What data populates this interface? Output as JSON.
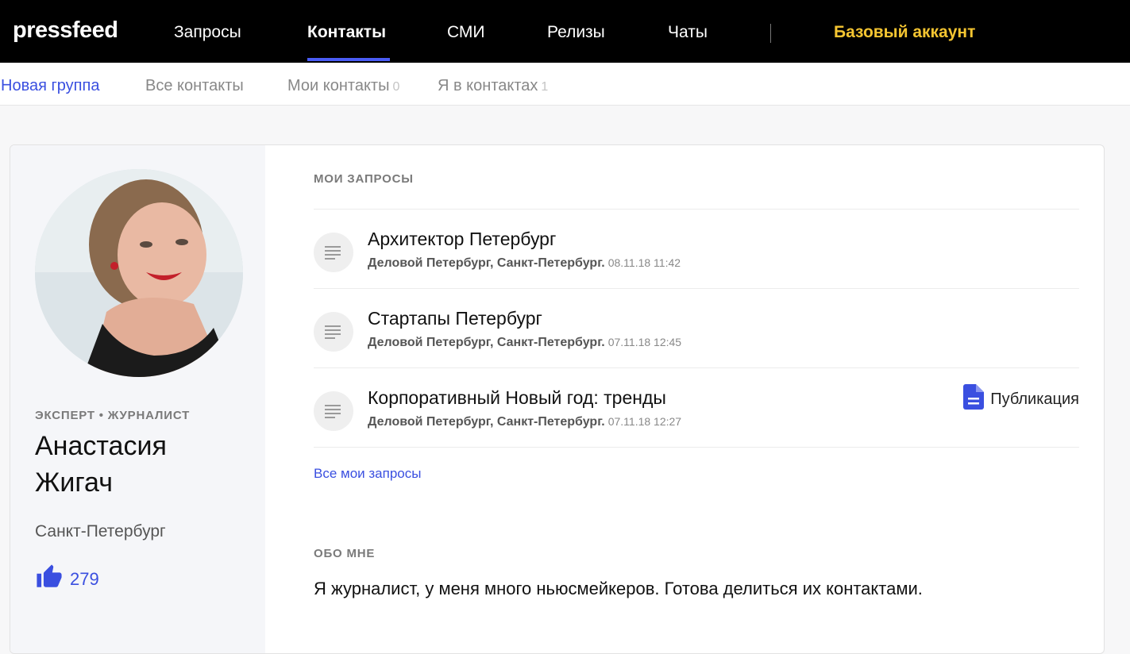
{
  "app": {
    "logo": "pressfeed"
  },
  "nav": {
    "items": [
      {
        "label": "Запросы",
        "active": false
      },
      {
        "label": "Контакты",
        "active": true
      },
      {
        "label": "СМИ",
        "active": false
      },
      {
        "label": "Релизы",
        "active": false
      },
      {
        "label": "Чаты",
        "active": false
      }
    ],
    "account": "Базовый аккаунт"
  },
  "subnav": {
    "new_group": "Новая группа",
    "all_contacts": "Все контакты",
    "my_contacts": {
      "label": "Мои контакты",
      "count": "0"
    },
    "in_contacts": {
      "label": "Я в контактах",
      "count": "1"
    }
  },
  "profile": {
    "role": "ЭКСПЕРТ • ЖУРНАЛИСТ",
    "name": "Анастасия Жигач",
    "city": "Санкт-Петербург",
    "likes": "279"
  },
  "requests": {
    "title": "МОИ ЗАПРОСЫ",
    "items": [
      {
        "title": "Архитектор Петербург",
        "source": "Деловой Петербург, Санкт-Петербург.",
        "date": "08.11.18 11:42",
        "badge": ""
      },
      {
        "title": "Стартапы Петербург",
        "source": "Деловой Петербург, Санкт-Петербург.",
        "date": "07.11.18 12:45",
        "badge": ""
      },
      {
        "title": "Корпоративный Новый год: тренды",
        "source": "Деловой Петербург, Санкт-Петербург.",
        "date": "07.11.18 12:27",
        "badge": "Публикация"
      }
    ],
    "all_link": "Все мои запросы"
  },
  "about": {
    "title": "ОБО МНЕ",
    "text": "Я журналист, у меня много ньюсмейкеров. Готова делиться их контактами."
  },
  "colors": {
    "accent": "#3a4fe0",
    "account": "#f5c531",
    "topbar": "#000000"
  },
  "icons": {
    "request": "document-lines-icon",
    "badge": "file-document-icon",
    "likes": "thumbs-up-icon"
  }
}
